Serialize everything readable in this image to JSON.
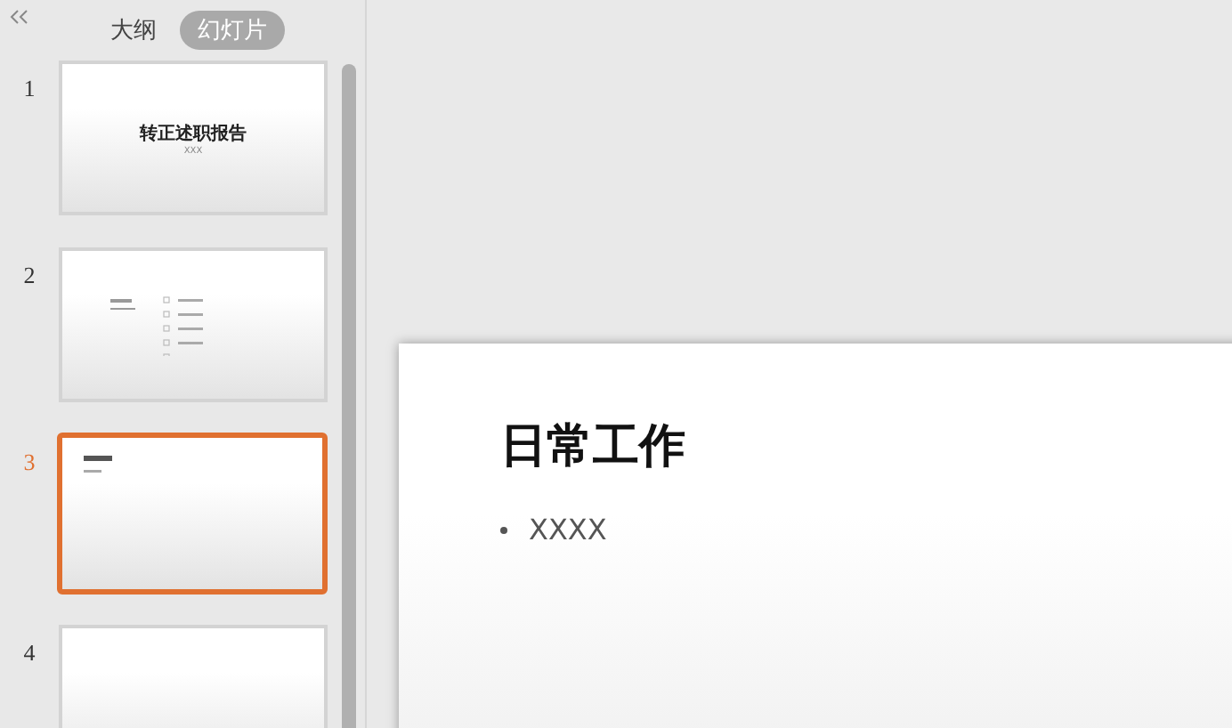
{
  "panel": {
    "tabs": [
      {
        "label": "大纲",
        "selected": false
      },
      {
        "label": "幻灯片",
        "selected": true
      }
    ],
    "slides": [
      {
        "number": "1",
        "selected": false,
        "kind": "title",
        "title": "转正述职报告",
        "subtitle": "XXX"
      },
      {
        "number": "2",
        "selected": false,
        "kind": "contents"
      },
      {
        "number": "3",
        "selected": true,
        "kind": "content"
      },
      {
        "number": "4",
        "selected": false,
        "kind": "blank"
      }
    ]
  },
  "current_slide": {
    "title": "日常工作",
    "bullets": [
      "XXXX"
    ]
  }
}
